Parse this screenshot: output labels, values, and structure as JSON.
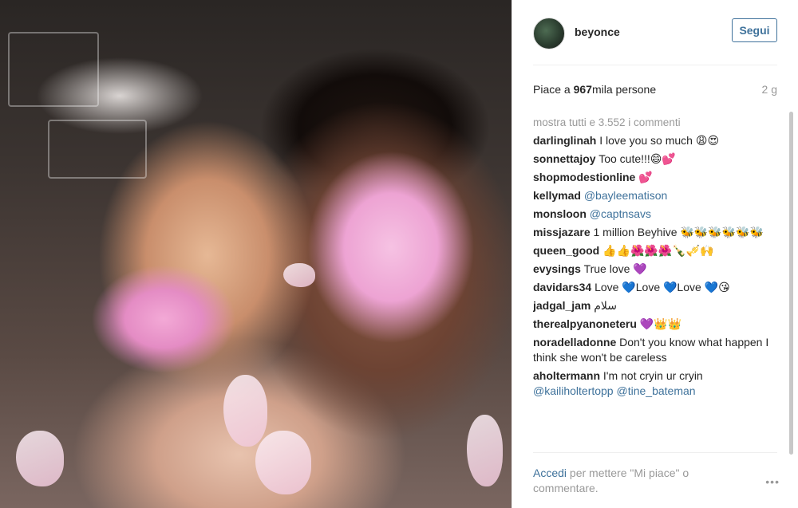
{
  "post": {
    "username": "beyonce",
    "follow_label": "Segui",
    "likes_prefix": "Piace a ",
    "likes_count": "967",
    "likes_suffix": "mila persone",
    "time_ago": "2 g",
    "show_all_comments": "mostra tutti e 3.552 i commenti"
  },
  "comments": [
    {
      "user": "darlinglinah",
      "text": "I love you so much 😩😍",
      "mentions": []
    },
    {
      "user": "sonnettajoy",
      "text": "Too cute!!!😄💕",
      "mentions": []
    },
    {
      "user": "shopmodestionline",
      "text": "💕",
      "mentions": []
    },
    {
      "user": "kellymad",
      "text": "",
      "mentions": [
        "@bayleematison"
      ]
    },
    {
      "user": "monsloon",
      "text": "",
      "mentions": [
        "@captnsavs"
      ]
    },
    {
      "user": "missjazare",
      "text": "1 million Beyhive 🐝🐝🐝🐝🐝🐝",
      "mentions": []
    },
    {
      "user": "queen_good",
      "text": "👍👍🌺🌺🌺🍾🎺🙌",
      "mentions": []
    },
    {
      "user": "evysings",
      "text": "True love 💜",
      "mentions": []
    },
    {
      "user": "davidars34",
      "text": "Love 💙Love 💙Love 💙😘",
      "mentions": []
    },
    {
      "user": "jadgal_jam",
      "text": "سلام",
      "mentions": []
    },
    {
      "user": "therealpyanoneteru",
      "text": "💜👑👑",
      "mentions": []
    },
    {
      "user": "noradelladonne",
      "text": "Don't you know what happen I think she won't be careless",
      "mentions": []
    },
    {
      "user": "aholtermann",
      "text": "I'm not cryin ur cryin",
      "mentions": [
        "@kailiholtertopp",
        "@tine_bateman"
      ]
    }
  ],
  "footer": {
    "login_label": "Accedi",
    "login_rest": " per mettere \"Mi piace\" o commentare.",
    "more_label": "•••"
  },
  "colors": {
    "link": "#3f729b",
    "muted": "#999999",
    "text": "#262626"
  },
  "icons": {
    "avatar": "profile-avatar",
    "more": "ellipsis-icon"
  }
}
